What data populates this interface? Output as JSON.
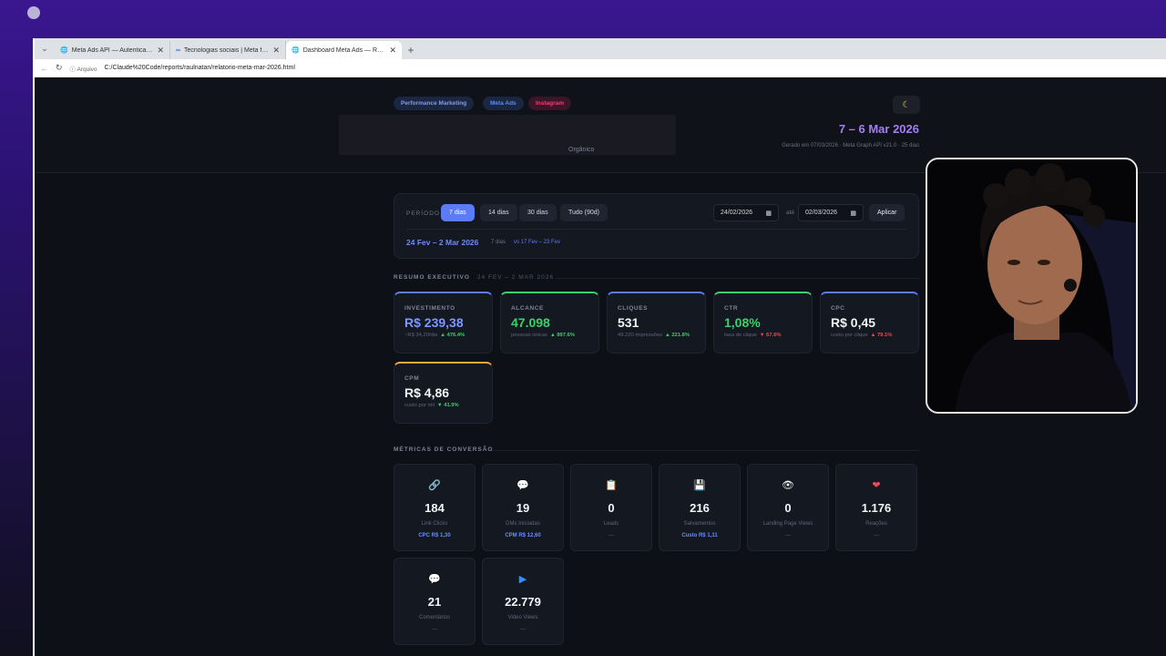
{
  "browser": {
    "tabs": [
      {
        "title": "Meta Ads API — Autenticação | Te",
        "icon": "globe-icon"
      },
      {
        "title": "Tecnologias sociais | Meta for Dev",
        "icon": "meta-icon"
      },
      {
        "title": "Dashboard Meta Ads — Raul Nata",
        "icon": "globe-icon"
      }
    ],
    "address_label": "Arquivo",
    "url": "C:/Claude%20Code/reports/raulnatan/relatorio-meta-mar-2026.html"
  },
  "header": {
    "tags": [
      "Performance Marketing",
      "Meta Ads",
      "Instagram"
    ],
    "organico": "Orgânico",
    "date_range": "7 – 6 Mar 2026",
    "generated": "Gerado em 07/03/2026 · Meta Graph API v21.0 · 25 dias"
  },
  "period": {
    "label": "PERÍODO",
    "buttons": [
      "7 dias",
      "14 dias",
      "30 dias",
      "Tudo (90d)"
    ],
    "date_from": "24/02/2026",
    "ate": "até",
    "date_to": "02/03/2026",
    "apply": "Aplicar",
    "range": "24 Fev – 2 Mar 2026",
    "days": "7 dias",
    "vs": "vs 17 Fev – 23 Fev"
  },
  "resumo": {
    "title": "RESUMO EXECUTIVO",
    "subtitle": "24 FEV – 2 MAR 2026",
    "cards": [
      {
        "label": "INVESTIMENTO",
        "value": "R$ 239,38",
        "foot": "~R$ 34,20/dia",
        "delta": "▲ 476.4%",
        "dir": "up",
        "accent": "#5b7cf6",
        "valcolor": "#7c97ff"
      },
      {
        "label": "ALCANCE",
        "value": "47.098",
        "foot": "pessoas únicas",
        "delta": "▲ 897.6%",
        "dir": "up",
        "accent": "#3ecf6a",
        "valcolor": "#3ecf6a"
      },
      {
        "label": "CLIQUES",
        "value": "531",
        "foot": "49.220 impressões",
        "delta": "▲ 221.8%",
        "dir": "up",
        "accent": "#5b7cf6",
        "valcolor": "#f2f4f8"
      },
      {
        "label": "CTR",
        "value": "1,08%",
        "foot": "taxa de clique",
        "delta": "▼ 67.6%",
        "dir": "dn",
        "accent": "#3ecf6a",
        "valcolor": "#3ecf6a"
      },
      {
        "label": "CPC",
        "value": "R$ 0,45",
        "foot": "custo por clique",
        "delta": "▲ 79.1%",
        "dir": "dn",
        "accent": "#5b7cf6",
        "valcolor": "#f2f4f8"
      },
      {
        "label": "CPM",
        "value": "R$ 4,86",
        "foot": "custo por mil",
        "delta": "▼ 41.9%",
        "dir": "up",
        "accent": "#f0a53a",
        "valcolor": "#f2f4f8"
      }
    ]
  },
  "conversao": {
    "title": "MÉTRICAS DE CONVERSÃO",
    "cards": [
      {
        "icon": "🔗",
        "icon_name": "link-icon",
        "value": "184",
        "label": "Link Clicks",
        "sub": "CPC R$ 1,30"
      },
      {
        "icon": "💬",
        "icon_name": "message-icon",
        "value": "19",
        "label": "DMs Iniciadas",
        "sub": "CPM R$ 12,60"
      },
      {
        "icon": "📋",
        "icon_name": "clipboard-icon",
        "value": "0",
        "label": "Leads",
        "sub": "—"
      },
      {
        "icon": "💾",
        "icon_name": "save-icon",
        "value": "216",
        "label": "Salvamentos",
        "sub": "Custo R$ 1,11"
      },
      {
        "icon": "👁",
        "icon_name": "eye-icon",
        "value": "0",
        "label": "Landing Page Views",
        "sub": "—"
      },
      {
        "icon": "❤",
        "icon_name": "heart-icon",
        "value": "1.176",
        "label": "Reações",
        "sub": "—"
      },
      {
        "icon": "💬",
        "icon_name": "comment-icon",
        "value": "21",
        "label": "Comentários",
        "sub": "—"
      },
      {
        "icon": "▶",
        "icon_name": "play-icon",
        "value": "22.779",
        "label": "Video Views",
        "sub": "—"
      }
    ]
  }
}
